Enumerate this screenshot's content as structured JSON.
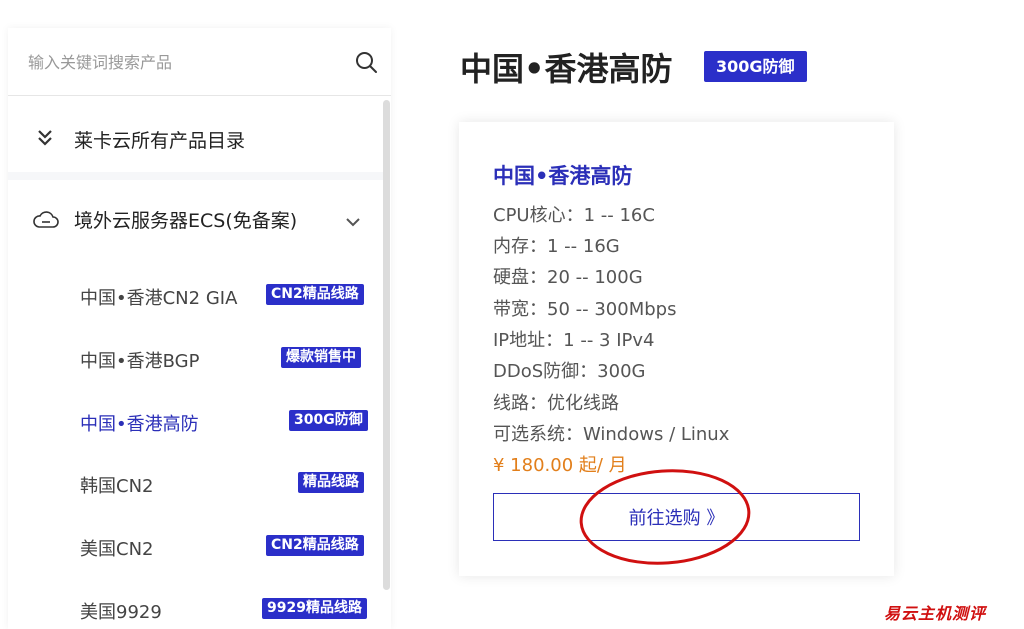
{
  "search": {
    "placeholder": "输入关键词搜索产品"
  },
  "catalog": {
    "label": "莱卡云所有产品目录"
  },
  "group": {
    "label": "境外云服务器ECS(免备案)",
    "items": [
      {
        "label": "中国•香港CN2 GIA",
        "badge": "CN2精品线路"
      },
      {
        "label": "中国•香港BGP",
        "badge": "爆款销售中"
      },
      {
        "label": "中国•香港高防",
        "badge": "300G防御"
      },
      {
        "label": "韩国CN2",
        "badge": "精品线路"
      },
      {
        "label": "美国CN2",
        "badge": "CN2精品线路"
      },
      {
        "label": "美国9929",
        "badge": "9929精品线路"
      }
    ]
  },
  "main": {
    "title": "中国•香港高防",
    "badge": "300G防御"
  },
  "card": {
    "title": "中国•香港高防",
    "specs": [
      "CPU核心：1 -- 16C",
      "内存：1 -- 16G",
      "硬盘：20 -- 100G",
      "带宽：50 -- 300Mbps",
      "IP地址：1 -- 3 IPv4",
      "DDoS防御：300G",
      "线路：优化线路",
      "可选系统：Windows / Linux"
    ],
    "price": "¥ 180.00 起/ 月",
    "buy_label": "前往选购 》"
  },
  "watermark": "易云主机测评",
  "colors": {
    "accent": "#2b2fc9",
    "price": "#e27f1b",
    "annotation": "#d01010"
  }
}
